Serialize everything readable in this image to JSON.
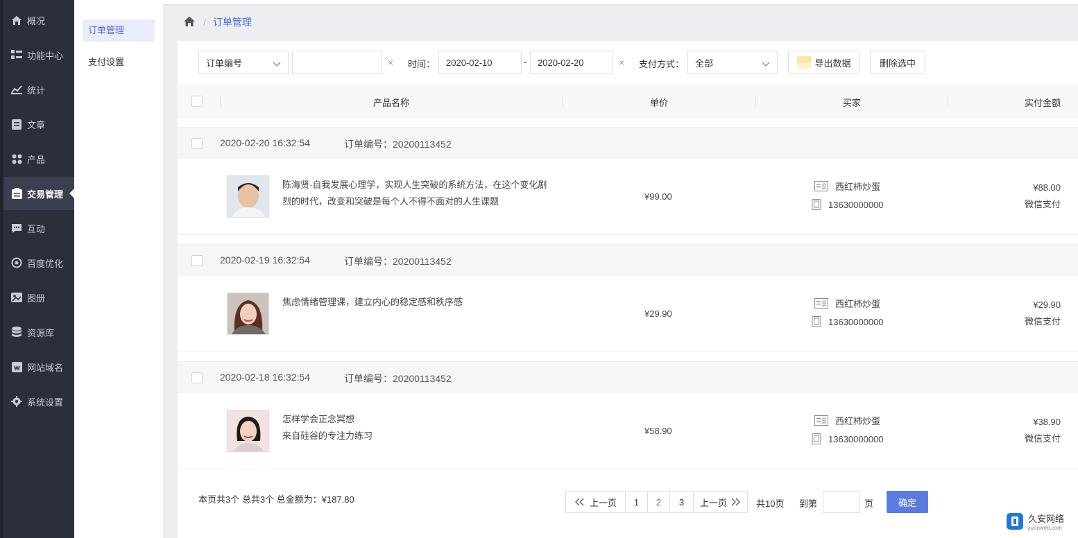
{
  "sidebar": {
    "items": [
      {
        "label": "概况",
        "icon": "home-icon"
      },
      {
        "label": "功能中心",
        "icon": "function-icon"
      },
      {
        "label": "统计",
        "icon": "stats-icon"
      },
      {
        "label": "文章",
        "icon": "article-icon"
      },
      {
        "label": "产品",
        "icon": "product-icon"
      },
      {
        "label": "交易管理",
        "icon": "transaction-icon"
      },
      {
        "label": "互动",
        "icon": "chat-icon"
      },
      {
        "label": "百度优化",
        "icon": "seo-icon"
      },
      {
        "label": "图册",
        "icon": "gallery-icon"
      },
      {
        "label": "资源库",
        "icon": "database-icon"
      },
      {
        "label": "网站域名",
        "icon": "domain-icon"
      },
      {
        "label": "系统设置",
        "icon": "settings-icon"
      }
    ],
    "active_index": 5
  },
  "submenu": {
    "items": [
      {
        "label": "订单管理"
      },
      {
        "label": "支付设置"
      }
    ]
  },
  "breadcrumb": {
    "sep": "/",
    "current": "订单管理"
  },
  "filters": {
    "field_select": "订单编号",
    "keyword_value": "",
    "time_label": "时间：",
    "date_from": "2020-02-10",
    "date_dash": "-",
    "date_to": "2020-02-20",
    "clear": "×",
    "pay_label": "支付方式：",
    "pay_select": "全部",
    "export_label": "导出数据",
    "delete_label": "删除选中"
  },
  "table": {
    "headers": {
      "product": "产品名称",
      "price": "单价",
      "buyer": "买家",
      "paid": "实付金额"
    }
  },
  "orders": [
    {
      "time": "2020-02-20 16:32:54",
      "order_no": "订单编号：20200113452",
      "name": "陈海贤·自我发展心理学，实现人生突破的系统方法，在这个变化剧烈的时代，改变和突破是每个人不得不面对的人生课题",
      "price": "¥99.00",
      "buyer": "西红柿炒蛋",
      "phone": "13630000000",
      "paid": "¥88.00",
      "pay_method": "微信支付"
    },
    {
      "time": "2020-02-19 16:32:54",
      "order_no": "订单编号：20200113452",
      "name": "焦虑情绪管理课，建立内心的稳定感和秩序感",
      "price": "¥29.90",
      "buyer": "西红柿炒蛋",
      "phone": "13630000000",
      "paid": "¥29.90",
      "pay_method": "微信支付"
    },
    {
      "time": "2020-02-18 16:32:54",
      "order_no": "订单编号：20200113452",
      "name": "怎样学会正念冥想\n来自硅谷的专注力练习",
      "price": "¥58.90",
      "buyer": "西红柿炒蛋",
      "phone": "13630000000",
      "paid": "¥38.90",
      "pay_method": "微信支付"
    }
  ],
  "footer": {
    "summary": "本页共3个 总共3个 总金额为：¥187.80",
    "prev": "上一页",
    "pages": [
      "1",
      "2",
      "3"
    ],
    "current_page": "2",
    "next": "上一页",
    "total_pages": "共10页",
    "goto_label": "到第",
    "goto_value": "",
    "page_unit": "页",
    "confirm": "确定"
  },
  "watermark": {
    "title": "久安网络",
    "url": "jiuonweb.com"
  },
  "colors": {
    "accent": "#4f6bd8",
    "sidebar_bg": "#2b2f3a",
    "button_primary": "#5b7be0"
  }
}
